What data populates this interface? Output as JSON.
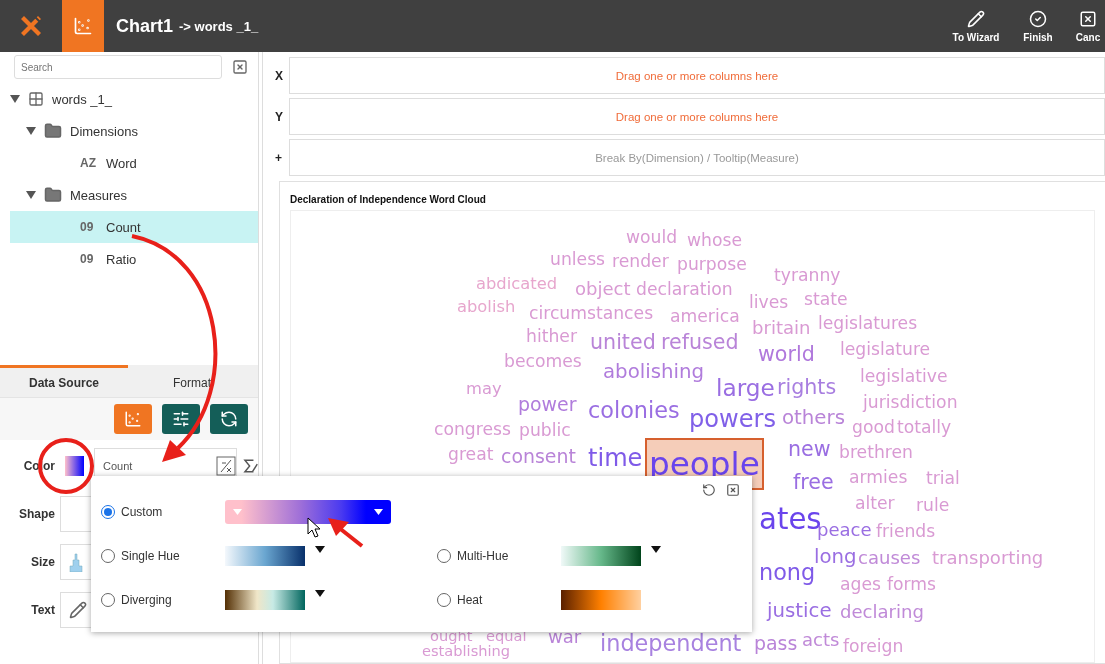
{
  "app_bar": {
    "title": "Chart1",
    "subtitle": "-> words _1_",
    "actions": [
      {
        "label": "To Wizard",
        "kind": "edit"
      },
      {
        "label": "Finish",
        "kind": "finish"
      },
      {
        "label": "Canc",
        "kind": "cancel"
      }
    ]
  },
  "sidebar": {
    "search": {
      "placeholder": "Search"
    },
    "tree": [
      {
        "label": "words _1_",
        "kind": "table",
        "expanded": true,
        "selected": false,
        "children": [
          {
            "label": "Dimensions",
            "kind": "folder",
            "expanded": true,
            "selected": false,
            "children": [
              {
                "label": "Word",
                "kind": "field",
                "type_badge": "AZ",
                "selected": false
              }
            ]
          },
          {
            "label": "Measures",
            "kind": "folder",
            "expanded": true,
            "selected": false,
            "children": [
              {
                "label": "Count",
                "kind": "field",
                "type_badge": "09",
                "selected": true
              },
              {
                "label": "Ratio",
                "kind": "field",
                "type_badge": "09",
                "selected": false
              }
            ]
          }
        ]
      }
    ],
    "tabs": [
      {
        "label": "Data Source",
        "selected": true
      },
      {
        "label": "Format",
        "selected": false
      }
    ],
    "toolbar": [
      {
        "kind": "chart",
        "active": true
      },
      {
        "kind": "filter",
        "active": false
      },
      {
        "kind": "swap",
        "active": false
      }
    ],
    "encodings": [
      {
        "label": "Color",
        "kind": "color",
        "field": "Count"
      },
      {
        "label": "Shape",
        "kind": "shape"
      },
      {
        "label": "Size",
        "kind": "size"
      },
      {
        "label": "Text",
        "kind": "text"
      }
    ]
  },
  "shelves": [
    {
      "label": "X",
      "kind": "drop",
      "placeholder": "Drag one or more columns here"
    },
    {
      "label": "Y",
      "kind": "drop",
      "placeholder": "Drag one or more columns here"
    },
    {
      "label": "+",
      "kind": "hint",
      "placeholder": "Break By(Dimension) / Tooltip(Measure)"
    }
  ],
  "chart": {
    "title": "Declaration of Independence Word Cloud",
    "words": [
      {
        "text": "would",
        "color": "#d99ad3",
        "selected": false
      },
      {
        "text": "whose",
        "color": "#d99ad3",
        "selected": false
      },
      {
        "text": "unless",
        "color": "#d99ad3",
        "selected": false
      },
      {
        "text": "render",
        "color": "#d99ad3",
        "selected": false
      },
      {
        "text": "purpose",
        "color": "#d99ad3",
        "selected": false
      },
      {
        "text": "abdicated",
        "color": "#e7a6cd",
        "selected": false
      },
      {
        "text": "object",
        "color": "#d99ad3",
        "selected": false
      },
      {
        "text": "declaration",
        "color": "#d99ad3",
        "selected": false
      },
      {
        "text": "tyranny",
        "color": "#d99ad3",
        "selected": false
      },
      {
        "text": "abolish",
        "color": "#e7a6cd",
        "selected": false
      },
      {
        "text": "circumstances",
        "color": "#d99ad3",
        "selected": false
      },
      {
        "text": "america",
        "color": "#d99ad3",
        "selected": false
      },
      {
        "text": "lives",
        "color": "#d99ad3",
        "selected": false
      },
      {
        "text": "state",
        "color": "#d99ad3",
        "selected": false
      },
      {
        "text": "hither",
        "color": "#d99ad3",
        "selected": false
      },
      {
        "text": "united",
        "color": "#b984d8",
        "selected": false
      },
      {
        "text": "refused",
        "color": "#b984d8",
        "selected": false
      },
      {
        "text": "britain",
        "color": "#d99ad3",
        "selected": false
      },
      {
        "text": "legislatures",
        "color": "#d99ad3",
        "selected": false
      },
      {
        "text": "becomes",
        "color": "#d99ad3",
        "selected": false
      },
      {
        "text": "abolishing",
        "color": "#b07cdc",
        "selected": false
      },
      {
        "text": "world",
        "color": "#b078dc",
        "selected": false
      },
      {
        "text": "legislature",
        "color": "#d99ad3",
        "selected": false
      },
      {
        "text": "may",
        "color": "#d99ad3",
        "selected": false
      },
      {
        "text": "large",
        "color": "#9a6ee2",
        "selected": false
      },
      {
        "text": "rights",
        "color": "#a87ee0",
        "selected": false
      },
      {
        "text": "legislative",
        "color": "#d99ad3",
        "selected": false
      },
      {
        "text": "power",
        "color": "#b07cdc",
        "selected": false
      },
      {
        "text": "colonies",
        "color": "#9a6ee2",
        "selected": false
      },
      {
        "text": "powers",
        "color": "#8060e8",
        "selected": false
      },
      {
        "text": "others",
        "color": "#b984d8",
        "selected": false
      },
      {
        "text": "jurisdiction",
        "color": "#d99ad3",
        "selected": false
      },
      {
        "text": "congress",
        "color": "#d99ad3",
        "selected": false
      },
      {
        "text": "public",
        "color": "#d99ad3",
        "selected": false
      },
      {
        "text": "good",
        "color": "#d99ad3",
        "selected": false
      },
      {
        "text": "totally",
        "color": "#d99ad3",
        "selected": false
      },
      {
        "text": "great",
        "color": "#d99ad3",
        "selected": false
      },
      {
        "text": "consent",
        "color": "#b984d8",
        "selected": false
      },
      {
        "text": "time",
        "color": "#7f5ae8",
        "selected": false
      },
      {
        "text": "people",
        "color": "#6a44ec",
        "selected": true
      },
      {
        "text": "new",
        "color": "#9a6ee2",
        "selected": false
      },
      {
        "text": "brethren",
        "color": "#d99ad3",
        "selected": false
      },
      {
        "text": "free",
        "color": "#9a6ee2",
        "selected": false
      },
      {
        "text": "armies",
        "color": "#d99ad3",
        "selected": false
      },
      {
        "text": "trial",
        "color": "#d99ad3",
        "selected": false
      },
      {
        "text": "alter",
        "color": "#d99ad3",
        "selected": false
      },
      {
        "text": "rule",
        "color": "#d99ad3",
        "selected": false
      },
      {
        "text": "ates",
        "color": "#6a44ec",
        "selected": false
      },
      {
        "text": "peace",
        "color": "#9a6ee2",
        "selected": false
      },
      {
        "text": "friends",
        "color": "#d99ad3",
        "selected": false
      },
      {
        "text": "long",
        "color": "#9a6ee2",
        "selected": false
      },
      {
        "text": "causes",
        "color": "#c08ad8",
        "selected": false
      },
      {
        "text": "transporting",
        "color": "#d99ad3",
        "selected": false
      },
      {
        "text": "nong",
        "color": "#7f5ae8",
        "selected": false
      },
      {
        "text": "ages",
        "color": "#d99ad3",
        "selected": false
      },
      {
        "text": "forms",
        "color": "#d99ad3",
        "selected": false
      },
      {
        "text": "justice",
        "color": "#9a6ee2",
        "selected": false
      },
      {
        "text": "declaring",
        "color": "#c08ad8",
        "selected": false
      },
      {
        "text": "establishing",
        "color": "#d99ad3",
        "selected": false
      },
      {
        "text": "ought",
        "color": "#d99ad3",
        "selected": false
      },
      {
        "text": "equal",
        "color": "#d99ad3",
        "selected": false
      },
      {
        "text": "war",
        "color": "#b984d8",
        "selected": false
      },
      {
        "text": "independent",
        "color": "#a882e0",
        "selected": false
      },
      {
        "text": "pass",
        "color": "#b984d8",
        "selected": false
      },
      {
        "text": "acts",
        "color": "#c08ad8",
        "selected": false
      },
      {
        "text": "foreign",
        "color": "#d99ad3",
        "selected": false
      }
    ]
  },
  "color_popup": {
    "schemes": [
      {
        "label": "Custom",
        "kind": "custom",
        "selected": true
      },
      {
        "label": "Single Hue",
        "kind": "single_hue",
        "selected": false
      },
      {
        "label": "Multi-Hue",
        "kind": "multi_hue",
        "selected": false
      },
      {
        "label": "Diverging",
        "kind": "diverging",
        "selected": false
      },
      {
        "label": "Heat",
        "kind": "heat",
        "selected": false
      }
    ]
  }
}
